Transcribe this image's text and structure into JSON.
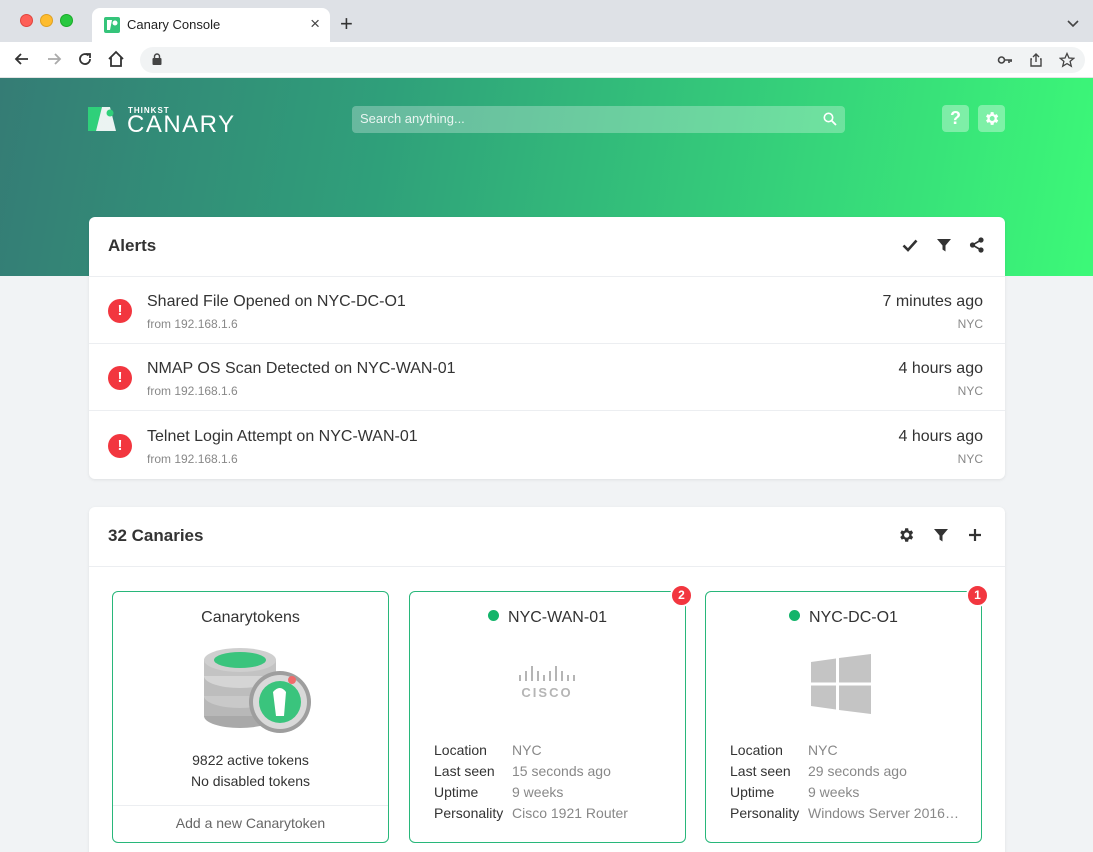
{
  "browser": {
    "tab_title": "Canary Console",
    "tab_close": "×",
    "new_tab": "+",
    "tab_menu": "⌄"
  },
  "header": {
    "logo_small": "THINKST",
    "logo_big": "CANARY",
    "search_placeholder": "Search anything...",
    "help_label": "?"
  },
  "alerts": {
    "title": "Alerts",
    "items": [
      {
        "title": "Shared File Opened on NYC-DC-O1",
        "from": "from 192.168.1.6",
        "time": "7 minutes ago",
        "location": "NYC",
        "icon_text": "!"
      },
      {
        "title": "NMAP OS Scan Detected on NYC-WAN-01",
        "from": "from 192.168.1.6",
        "time": "4 hours ago",
        "location": "NYC",
        "icon_text": "!"
      },
      {
        "title": "Telnet Login Attempt on NYC-WAN-01",
        "from": "from 192.168.1.6",
        "time": "4 hours ago",
        "location": "NYC",
        "icon_text": "!"
      }
    ]
  },
  "canaries": {
    "title": "32 Canaries",
    "tokens": {
      "title": "Canarytokens",
      "active": "9822 active tokens",
      "disabled": "No disabled tokens",
      "add_label": "Add a new Canarytoken"
    },
    "devices": [
      {
        "name": "NYC-WAN-01",
        "badge": "2",
        "logo": "cisco-logo",
        "logo_text": "CISCO",
        "labels": [
          "Location",
          "Last seen",
          "Uptime",
          "Personality"
        ],
        "values": [
          "NYC",
          "15 seconds ago",
          "9 weeks",
          "Cisco 1921 Router"
        ]
      },
      {
        "name": "NYC-DC-O1",
        "badge": "1",
        "logo": "windows-logo",
        "labels": [
          "Location",
          "Last seen",
          "Uptime",
          "Personality"
        ],
        "values": [
          "NYC",
          "29 seconds ago",
          "9 weeks",
          "Windows Server 2016…"
        ]
      }
    ]
  },
  "colors": {
    "accent_green": "#28b77a",
    "alert_red": "#f2363f",
    "status_green": "#13b46a"
  }
}
